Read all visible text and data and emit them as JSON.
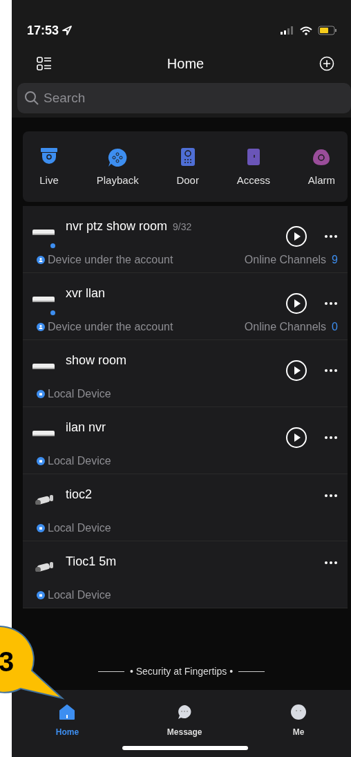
{
  "status_bar": {
    "time": "17:53"
  },
  "header": {
    "title": "Home"
  },
  "search": {
    "placeholder": "Search"
  },
  "quick_actions": [
    {
      "label": "Live",
      "kind": "live",
      "color": "#3d8ef0"
    },
    {
      "label": "Playback",
      "kind": "playback",
      "color": "#3d8ef0"
    },
    {
      "label": "Door",
      "kind": "door",
      "color": "#4f6fd6"
    },
    {
      "label": "Access",
      "kind": "access",
      "color": "#6a55b8"
    },
    {
      "label": "Alarm",
      "kind": "alarm",
      "color": "#9a4d9a"
    }
  ],
  "devices": [
    {
      "name": "nvr ptz show room",
      "count": "9/32",
      "kind": "recorder",
      "online_dot": true,
      "source": {
        "text": "Device under the account",
        "kind": "account"
      },
      "channels_label": "Online Channels",
      "channels": "9",
      "playable": true
    },
    {
      "name": "xvr llan",
      "kind": "recorder",
      "online_dot": true,
      "source": {
        "text": "Device under the account",
        "kind": "account"
      },
      "channels_label": "Online Channels",
      "channels": "0",
      "playable": true
    },
    {
      "name": "show room",
      "kind": "recorder",
      "online_dot": false,
      "source": {
        "text": "Local Device",
        "kind": "local"
      },
      "playable": true
    },
    {
      "name": "ilan nvr",
      "kind": "recorder",
      "online_dot": false,
      "source": {
        "text": "Local Device",
        "kind": "local"
      },
      "playable": true
    },
    {
      "name": "tioc2",
      "kind": "camera",
      "online_dot": false,
      "source": {
        "text": "Local Device",
        "kind": "local"
      },
      "playable": false
    },
    {
      "name": "Tioc1 5m",
      "kind": "camera",
      "online_dot": false,
      "source": {
        "text": "Local Device",
        "kind": "local"
      },
      "playable": false
    }
  ],
  "tagline": "• Security at Fingertips •",
  "tabs": [
    {
      "label": "Home",
      "kind": "home",
      "selected": true
    },
    {
      "label": "Message",
      "kind": "message",
      "selected": false
    },
    {
      "label": "Me",
      "kind": "me",
      "selected": false
    }
  ],
  "callout": {
    "text": "3"
  }
}
